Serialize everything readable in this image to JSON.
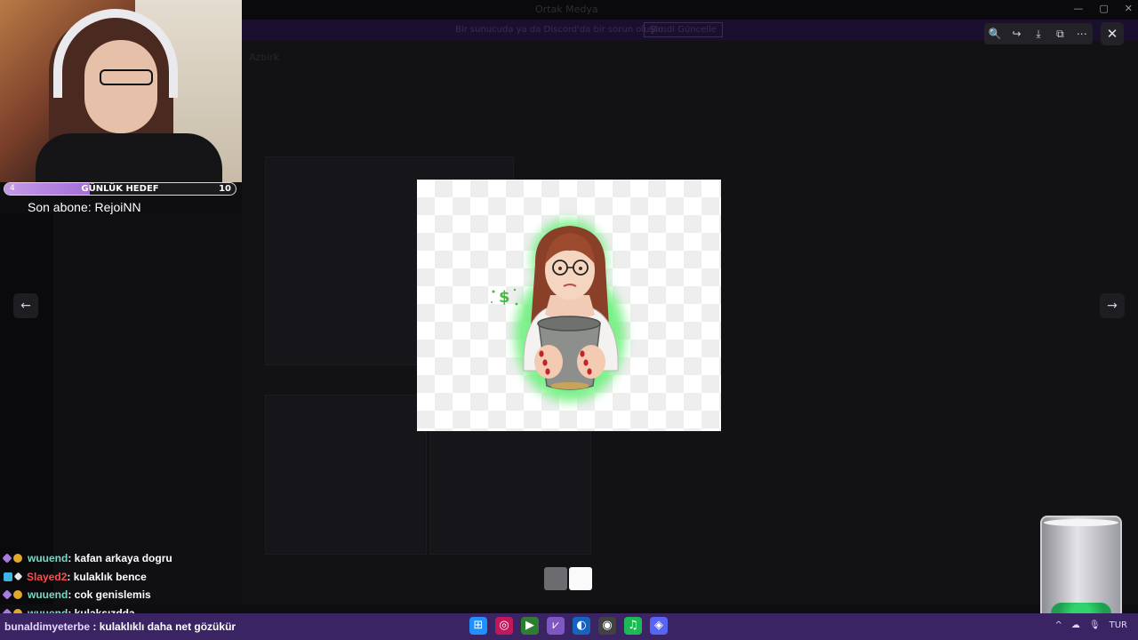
{
  "app": {
    "title": "Ortak Medya",
    "banner_text": "Bir sunucuda ya da Discord'da bir sorun oluştu.",
    "banner_button": "Şimdi Güncelle",
    "channel_name": "Azbirk"
  },
  "window_controls": [
    "—",
    "▢",
    "✕"
  ],
  "stream": {
    "goal_label": "GÜNLÜK HEDEF",
    "goal_current": "4",
    "goal_max": "10",
    "goal_fraction": 0.37,
    "last_sub": "Son abone: RejoiNN"
  },
  "viewer": {
    "toolbar_icons": [
      "zoom-icon",
      "forward-icon",
      "download-icon",
      "open-external-icon",
      "more-icon"
    ],
    "toolbar_glyphs": [
      "🔍",
      "↪",
      "⤓",
      "⧉",
      "⋯"
    ],
    "close_glyph": "✕",
    "prev_glyph": "←",
    "next_glyph": "→",
    "sparkle_glyph": "$",
    "thumbnail_count": 2,
    "active_thumbnail": 1
  },
  "chat": [
    {
      "badges": [
        "b-purple",
        "b-gold"
      ],
      "user": "wuuend",
      "user_color": "u-green",
      "message": " : kafan arkaya dogru"
    },
    {
      "badges": [
        "b-blue",
        "b-white"
      ],
      "user": "Slayed2",
      "user_color": "u-red",
      "message": " : kulaklık bence"
    },
    {
      "badges": [
        "b-purple",
        "b-gold"
      ],
      "user": "wuuend",
      "user_color": "u-green",
      "message": " : cok genislemis"
    },
    {
      "badges": [
        "b-purple",
        "b-gold"
      ],
      "user": "wuuend",
      "user_color": "u-green",
      "message": " : kulaksızdda"
    }
  ],
  "taskbar": {
    "last_user": "bunaldimyeterbe",
    "last_message": " : kulaklıklı daha net gözükür",
    "apps": [
      "windows-icon",
      "app-circle-icon",
      "terminal-icon",
      "vs-icon",
      "edge-icon",
      "obs-icon",
      "spotify-icon",
      "discord-icon"
    ],
    "app_glyphs": [
      "⊞",
      "◎",
      "▶",
      "⩗",
      "◐",
      "◉",
      "♫",
      "◈"
    ],
    "tray_lang": "TUR",
    "tray_glyphs": [
      "^",
      "☁",
      "🎙"
    ]
  },
  "colors": {
    "taskbar": "#3a2463",
    "goal_fill": "#a46fd6",
    "chat_user_green": "#7ad9c5",
    "chat_user_red": "#ff4d4d"
  }
}
